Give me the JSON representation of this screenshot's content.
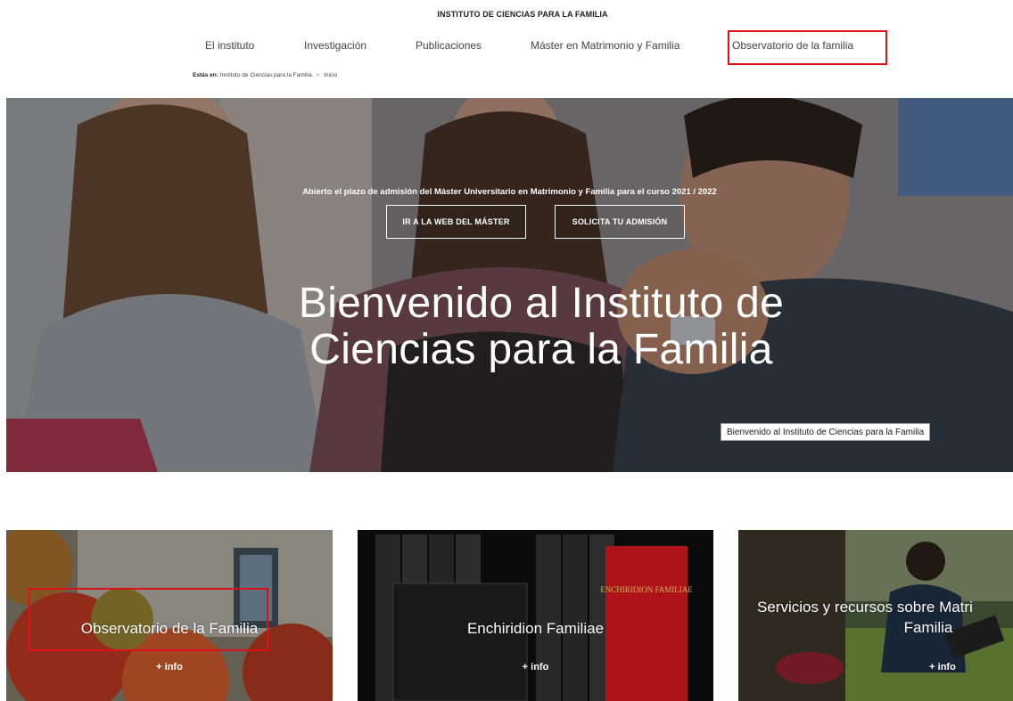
{
  "header": {
    "site_title": "INSTITUTO DE CIENCIAS PARA LA FAMILIA"
  },
  "nav": {
    "items": [
      {
        "label": "El instituto"
      },
      {
        "label": "Investigación"
      },
      {
        "label": "Publicaciones"
      },
      {
        "label": "Máster en Matrimonio y Familia"
      },
      {
        "label": "Observatorio de la familia"
      }
    ]
  },
  "breadcrumb": {
    "label": "Estás en:",
    "path": [
      "Instituto de Ciencias para la Familia",
      "Inicio"
    ],
    "separator": ">"
  },
  "hero": {
    "banner_text": "Abierto el plazo de admisión del Máster Universitario en Matrimonio y Familia para el curso 2021 / 2022",
    "buttons": [
      {
        "label": "IR A LA WEB DEL MÁSTER"
      },
      {
        "label": "SOLICITA TU ADMISIÓN"
      }
    ],
    "heading_line1": "Bienvenido al Instituto de",
    "heading_line2": "Ciencias para la Familia",
    "tooltip": "Bienvenido al Instituto de Ciencias para la Familia"
  },
  "cards": [
    {
      "title": "Observatorio de la Familia",
      "more": "+ info"
    },
    {
      "title": "Enchiridion Familiae",
      "more": "+ info",
      "book_spine_text": "ENCHIRIDION FAMILIAE"
    },
    {
      "title_line1": "Servicios y recursos sobre Matri",
      "title_line2": "Familia",
      "more": "+ info"
    }
  ],
  "colors": {
    "highlight": "#e0101a",
    "book_red": "#c2161c",
    "text_white": "#ffffff"
  }
}
